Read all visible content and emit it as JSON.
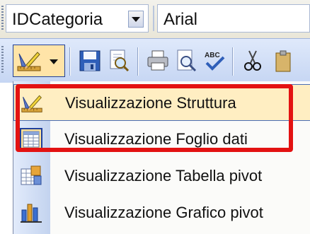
{
  "selectors": {
    "field_combo_value": "IDCategoria",
    "font_combo_value": "Arial"
  },
  "toolbar": {
    "view_button_icon": "design-view-icon",
    "icons": [
      "save-icon",
      "preview-icon",
      "print-icon",
      "print-preview-icon",
      "spelling-icon",
      "cut-icon"
    ]
  },
  "view_menu": {
    "items": [
      {
        "label": "Visualizzazione Struttura",
        "icon": "design-view-icon",
        "highlighted": true
      },
      {
        "label": "Visualizzazione Foglio dati",
        "icon": "datasheet-view-icon",
        "highlighted": false
      },
      {
        "label": "Visualizzazione Tabella pivot",
        "icon": "pivot-table-icon",
        "highlighted": false
      },
      {
        "label": "Visualizzazione Grafico pivot",
        "icon": "pivot-chart-icon",
        "highlighted": false
      }
    ]
  },
  "colors": {
    "highlight": "#ffeec2",
    "annotation_box": "#e31212",
    "toolbar": "#c6d6f3"
  }
}
